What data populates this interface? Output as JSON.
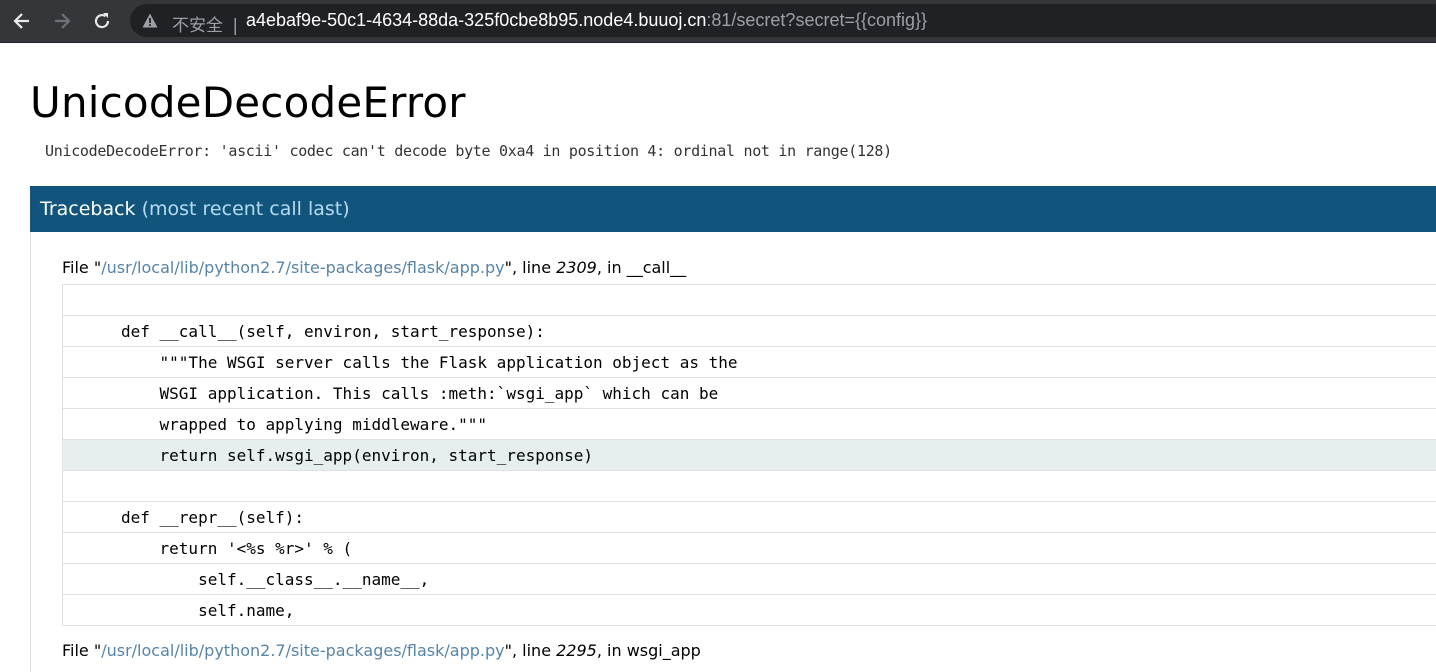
{
  "browser": {
    "security_label": "不安全",
    "separator": "|",
    "url_host": "a4ebaf9e-50c1-4634-88da-325f0cbe8b95.node4.buuoj.cn",
    "url_rest": ":81/secret?secret={{config}}"
  },
  "page": {
    "title": "UnicodeDecodeError",
    "error_message": "UnicodeDecodeError: 'ascii' codec can't decode byte 0xa4 in position 4: ordinal not in range(128)",
    "traceback_title": "Traceback",
    "traceback_subtitle": "(most recent call last)"
  },
  "frames": [
    {
      "file_prefix": "File \"",
      "path": "/usr/local/lib/python2.7/site-packages/flask/app.py",
      "line_prefix": "\", line ",
      "line": "2309",
      "in_prefix": ", in ",
      "func": "__call__"
    },
    {
      "file_prefix": "File \"",
      "path": "/usr/local/lib/python2.7/site-packages/flask/app.py",
      "line_prefix": "\", line ",
      "line": "2295",
      "in_prefix": ", in ",
      "func": "wsgi_app"
    }
  ],
  "source_lines": [
    "",
    "def __call__(self, environ, start_response):",
    "    \"\"\"The WSGI server calls the Flask application object as the",
    "    WSGI application. This calls :meth:`wsgi_app` which can be",
    "    wrapped to applying middleware.\"\"\"",
    "    return self.wsgi_app(environ, start_response)",
    "",
    "def __repr__(self):",
    "    return '<%s %r>' % (",
    "        self.__class__.__name__,",
    "        self.name,"
  ],
  "current_line_index": 5,
  "colors": {
    "header_bg": "#11557c",
    "header_sub": "#b6dbf2",
    "path": "#5784a8",
    "current_line_bg": "#e6eeee"
  },
  "icons": [
    "back-arrow-icon",
    "forward-arrow-icon",
    "reload-icon",
    "warning-icon"
  ]
}
